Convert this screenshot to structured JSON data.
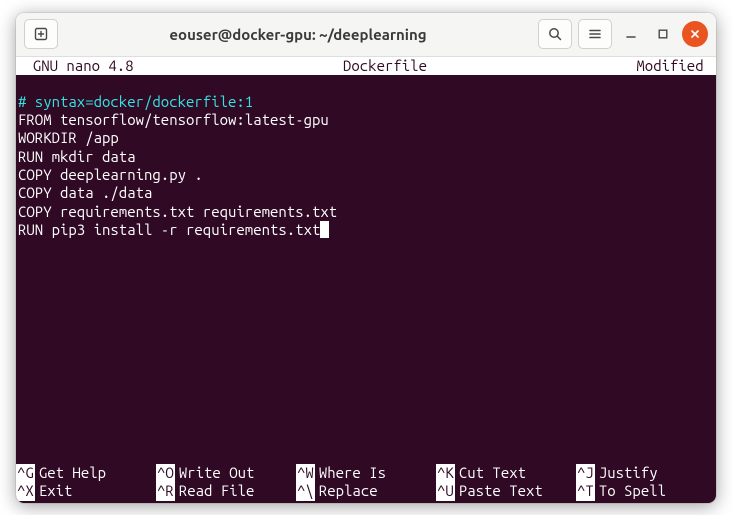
{
  "titlebar": {
    "title": "eouser@docker-gpu: ~/deeplearning"
  },
  "nano": {
    "app_version": "  GNU nano 4.8",
    "filename": "Dockerfile",
    "status": "Modified "
  },
  "file": {
    "line1_comment": "# syntax=docker/dockerfile:1",
    "line2": "FROM tensorflow/tensorflow:latest-gpu",
    "line3": "WORKDIR /app",
    "line4": "RUN mkdir data",
    "line5": "COPY deeplearning.py .",
    "line6": "COPY data ./data",
    "line7": "COPY requirements.txt requirements.txt",
    "line8": "RUN pip3 install -r requirements.txt"
  },
  "shortcuts": {
    "row1": [
      {
        "key": "^G",
        "label": "Get Help"
      },
      {
        "key": "^O",
        "label": "Write Out"
      },
      {
        "key": "^W",
        "label": "Where Is"
      },
      {
        "key": "^K",
        "label": "Cut Text"
      },
      {
        "key": "^J",
        "label": "Justify"
      }
    ],
    "row2": [
      {
        "key": "^X",
        "label": "Exit"
      },
      {
        "key": "^R",
        "label": "Read File"
      },
      {
        "key": "^\\",
        "label": "Replace"
      },
      {
        "key": "^U",
        "label": "Paste Text"
      },
      {
        "key": "^T",
        "label": "To Spell"
      }
    ]
  }
}
